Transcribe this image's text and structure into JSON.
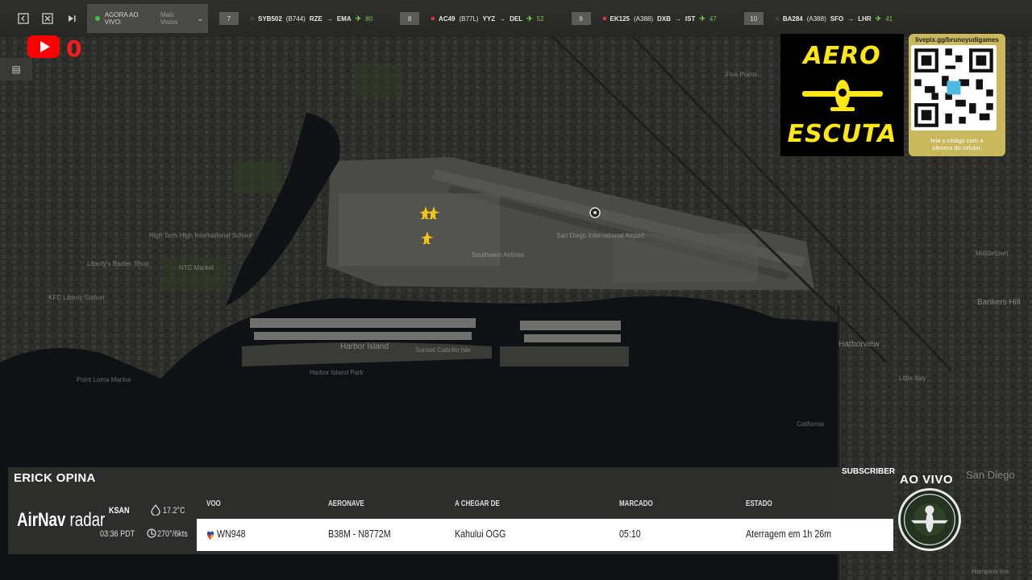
{
  "topbar": {
    "now_live_label": "AGORA AO VIVO:",
    "now_live_value": "Mais Vistos",
    "flights": [
      {
        "index": "7",
        "callsign": "SYB502",
        "aircraft": "(B744)",
        "from": "RZE",
        "to": "EMA",
        "distance": "80",
        "square_color": "#d33333"
      },
      {
        "index": "8",
        "callsign": "AC49",
        "aircraft": "(B77L)",
        "from": "YYZ",
        "to": "DEL",
        "distance": "52",
        "square_color": "#d33333"
      },
      {
        "index": "9",
        "callsign": "EK125",
        "aircraft": "(A388)",
        "from": "DXB",
        "to": "IST",
        "distance": "47",
        "square_color": "#d33333"
      },
      {
        "index": "10",
        "callsign": "BA284",
        "aircraft": "(A388)",
        "from": "SFO",
        "to": "LHR",
        "distance": "41",
        "square_color": "#444444"
      }
    ]
  },
  "youtube": {
    "count": "0"
  },
  "aero_logo": {
    "line1": "AERO",
    "line2": "ESCUTA"
  },
  "qr": {
    "url": "livepix.gg/brunoyudigames",
    "caption_line1": "leia o código com a",
    "caption_line2": "câmera do celular."
  },
  "map_labels": [
    "Five Points",
    "High Tech High International School",
    "Liberty's Barber Shop",
    "NTC Market",
    "KFC Liberty Station",
    "Point Loma Marina",
    "Harbor Island",
    "Harbor Island Park",
    "Sunset Cabrillo Isle",
    "San Diego International Airport",
    "Southwest Airlines",
    "Harborview",
    "Bankers Hill",
    "San Diego",
    "California",
    "Little Italy",
    "Middletown",
    "Hampton Inn"
  ],
  "panel": {
    "source_label": "SUBSCRIBER",
    "live_label": "AO VIVO",
    "streamer": "ERICK OPINA",
    "brand_a": "AirNav",
    "brand_b": "radar",
    "airport": "KSAN",
    "time": "03:36 PDT",
    "temperature": "17.2°C",
    "wind": "270°/6kts",
    "headers": {
      "flight": "VOO",
      "aircraft": "AERONAVE",
      "from": "A CHEGAR DE",
      "scheduled": "MARCADO",
      "status": "ESTADO"
    },
    "row": {
      "flight": "WN948",
      "aircraft": "B38M - N8772M",
      "from": "Kahului OGG",
      "scheduled": "05:10",
      "status": "Aterragem em 1h 26m"
    }
  },
  "colors": {
    "accent_yellow": "#ffe812",
    "live_green": "#3fc43f",
    "youtube_red": "#ff0000",
    "plane_yellow": "#f0c419"
  }
}
